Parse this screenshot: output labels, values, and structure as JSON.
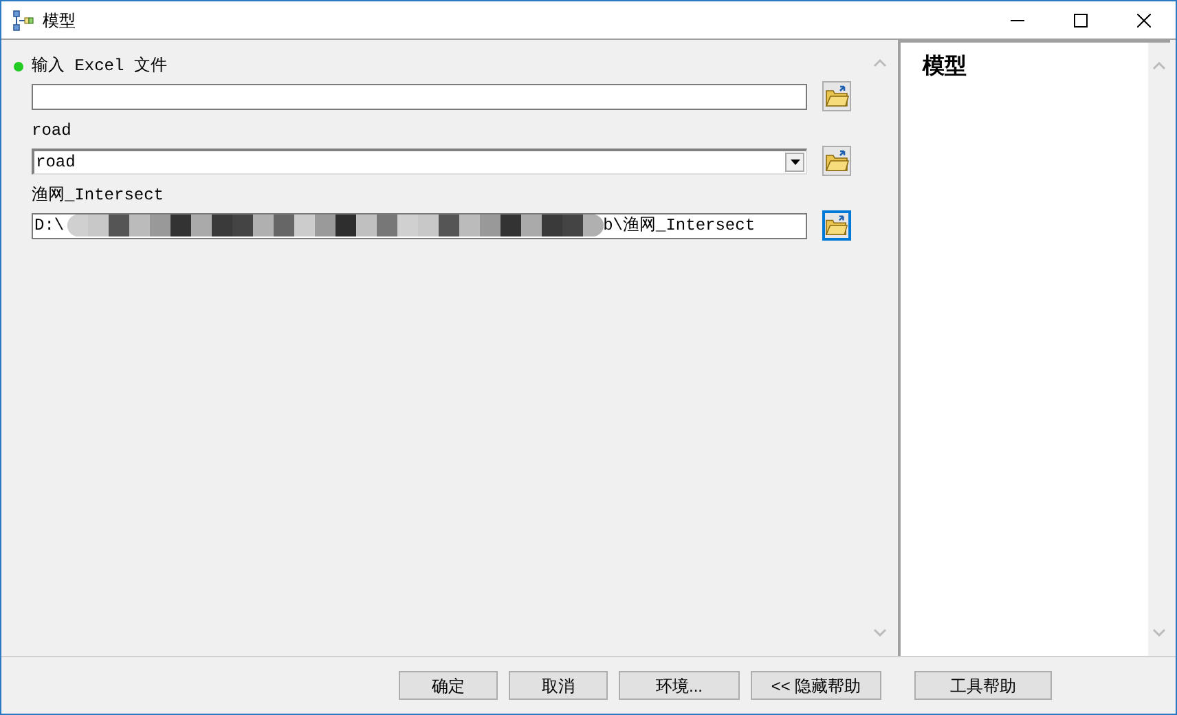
{
  "window": {
    "title": "模型"
  },
  "parameters": [
    {
      "kind": "text",
      "label": "输入 Excel 文件",
      "required": true,
      "focused": false
    },
    {
      "kind": "combo",
      "label": "road",
      "required": false,
      "value": "road",
      "focused": false
    },
    {
      "kind": "redacted",
      "label": "渔网_Intersect",
      "required": false,
      "value": "D:\\",
      "value_end": "b\\渔网_Intersect",
      "focused": true
    }
  ],
  "help_panel": {
    "title": "模型"
  },
  "buttons": [
    "确定",
    "取消",
    "环境...",
    "<< 隐藏帮助",
    "工具帮助"
  ]
}
